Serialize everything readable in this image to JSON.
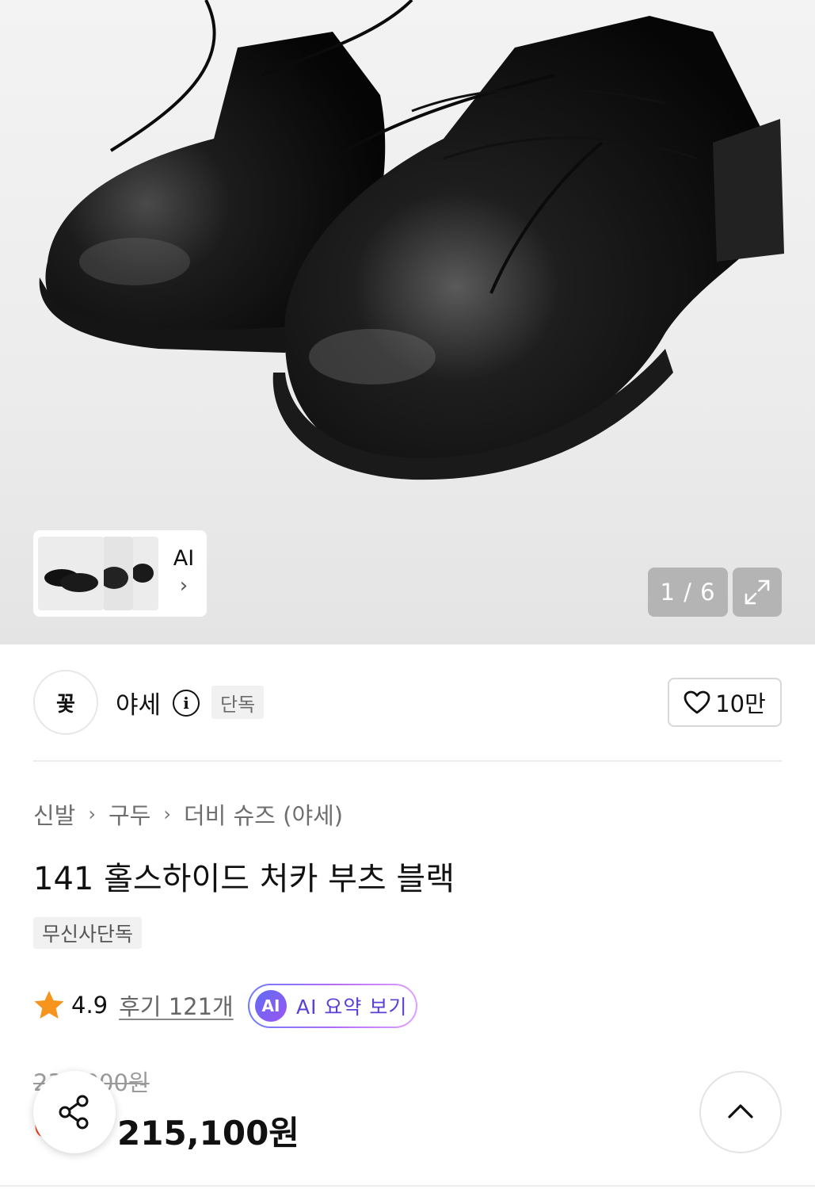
{
  "gallery": {
    "ai_more_label": "AI",
    "ai_more_chevron": "›",
    "counter": "1 / 6",
    "expand_icon": "expand-icon"
  },
  "brand": {
    "logo_text": "꽃",
    "name": "야세",
    "info_icon": "i",
    "badge": "단독",
    "like_count": "10만"
  },
  "breadcrumb": {
    "items": [
      "신발",
      "구두",
      "더비 슈즈 (야세)"
    ],
    "separator": "›"
  },
  "product": {
    "title": "141 홀스하이드 처카 부츠 블랙",
    "tag": "무신사단독"
  },
  "rating": {
    "value": "4.9",
    "reviews": "후기 121개",
    "ai_badge": "AI",
    "ai_summary": "AI 요약 보기"
  },
  "price": {
    "original": "230,000원",
    "discount": "6%",
    "sale": "215,100원"
  },
  "colors": {
    "accent_red": "#f2421b",
    "star": "#f7941d",
    "ai_purple": "#5b3fd6"
  }
}
